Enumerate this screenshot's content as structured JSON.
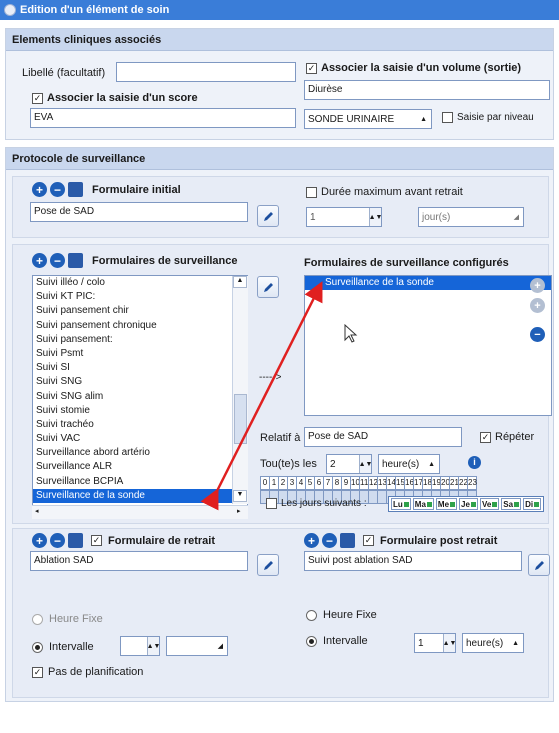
{
  "window": {
    "title": "Edition d'un élément de soin"
  },
  "clinical": {
    "header": "Elements cliniques associés",
    "label_field": {
      "label": "Libellé (facultatif)",
      "value": ""
    },
    "score": {
      "label": "Associer la saisie d'un score",
      "checked": true,
      "value": "EVA"
    },
    "volume": {
      "label": "Associer la saisie d'un volume (sortie)",
      "checked": true,
      "value": "Diurèse",
      "select": "SONDE URINAIRE",
      "per_level_label": "Saisie par niveau",
      "per_level_checked": false
    }
  },
  "protocol": {
    "header": "Protocole de surveillance",
    "initial": {
      "title": "Formulaire initial",
      "value": "Pose de SAD",
      "max_duration_label": "Durée maximum avant retrait",
      "max_duration_checked": false,
      "duration_value": "1",
      "duration_unit": "jour(s)"
    },
    "monitoring": {
      "title": "Formulaires de surveillance",
      "items": [
        "Suivi illéo / colo",
        "Suivi KT PIC:",
        "Suivi pansement chir",
        "Suivi pansement chronique",
        "Suivi pansement:",
        "Suivi Psmt",
        "Suivi SI",
        "Suivi SNG",
        "Suivi SNG alim",
        "Suivi stomie",
        "Suivi trachéo",
        "Suivi VAC",
        "Surveillance abord artério",
        "Surveillance ALR",
        "Surveillance BCPIA",
        "Surveillance de la sonde"
      ],
      "selected": "Surveillance de la sonde",
      "arrow": "----->"
    },
    "configured": {
      "title": "Formulaires de surveillance configurés",
      "items": [
        "Surveillance de la sonde"
      ],
      "relative_label": "Relatif à",
      "relative_value": "Pose de SAD",
      "repeat_label": "Répéter",
      "repeat_checked": true,
      "every_label": "Tou(te)s les",
      "every_value": "2",
      "every_unit": "heure(s)",
      "hours": [
        "0",
        "1",
        "2",
        "3",
        "4",
        "5",
        "6",
        "7",
        "8",
        "9",
        "10",
        "11",
        "12",
        "13",
        "14",
        "15",
        "16",
        "17",
        "18",
        "19",
        "20",
        "21",
        "22",
        "23"
      ],
      "following_days_label": "Les jours suivants :",
      "following_days_checked": false,
      "days": [
        "Lu",
        "Ma",
        "Me",
        "Je",
        "Ve",
        "Sa",
        "Di"
      ]
    }
  },
  "withdrawal": {
    "title": "Formulaire de retrait",
    "checked": true,
    "value": "Ablation SAD",
    "fixed_hour_label": "Heure Fixe",
    "interval_label": "Intervalle",
    "interval_selected": true,
    "no_planning_label": "Pas de planification",
    "no_planning_checked": true
  },
  "post_withdrawal": {
    "title": "Formulaire post retrait",
    "checked": true,
    "value": "Suivi post ablation SAD",
    "fixed_hour_label": "Heure Fixe",
    "interval_label": "Intervalle",
    "interval_selected": true,
    "interval_value": "1",
    "interval_unit": "heure(s)"
  },
  "colors": {
    "accent": "#1565d8",
    "header_bg": "#c9d7ee",
    "annotation_red": "#e02020"
  }
}
